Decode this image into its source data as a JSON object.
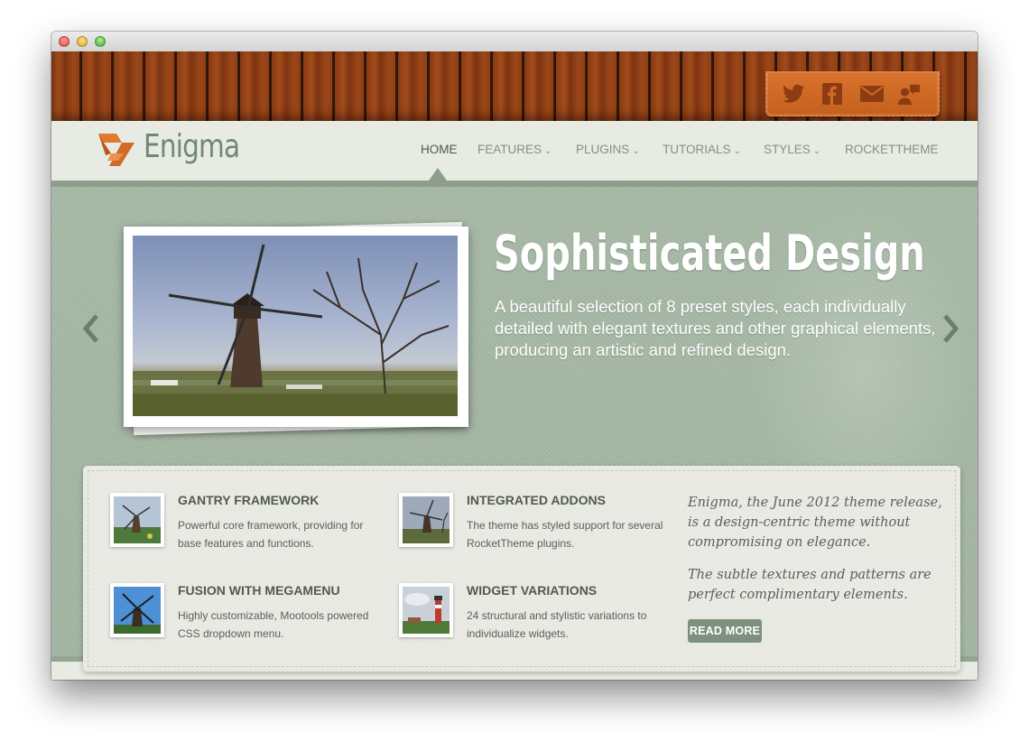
{
  "site": {
    "logo_text": "Enigma",
    "nav": [
      {
        "label": "HOME",
        "dropdown": false,
        "active": true
      },
      {
        "label": "FEATURES",
        "dropdown": true,
        "active": false
      },
      {
        "label": "PLUGINS",
        "dropdown": true,
        "active": false
      },
      {
        "label": "TUTORIALS",
        "dropdown": true,
        "active": false
      },
      {
        "label": "STYLES",
        "dropdown": true,
        "active": false
      },
      {
        "label": "ROCKETTHEME",
        "dropdown": false,
        "active": false
      }
    ],
    "dropdown_glyph": "⌄"
  },
  "social_icons": [
    "twitter-icon",
    "facebook-icon",
    "email-icon",
    "chat-icon"
  ],
  "slide": {
    "title": "Sophisticated Design",
    "text": "A beautiful selection of 8 preset styles, each individually detailed with elegant textures and other graphical elements, producing an artistic and refined design.",
    "image": "windmill-photo"
  },
  "features": [
    {
      "title": "GANTRY FRAMEWORK",
      "text": "Powerful core framework, providing for base features and functions.",
      "image": "windmill-thumb"
    },
    {
      "title": "INTEGRATED ADDONS",
      "text": "The theme has styled support for several RocketTheme plugins.",
      "image": "windmill-thumb"
    },
    {
      "title": "FUSION WITH MEGAMENU",
      "text": "Highly customizable, Mootools powered CSS dropdown menu.",
      "image": "windmill-blue-sky-thumb"
    },
    {
      "title": "WIDGET VARIATIONS",
      "text": "24 structural and stylistic variations to individualize widgets.",
      "image": "lighthouse-thumb"
    }
  ],
  "intro": {
    "paragraph_1": "Enigma, the June 2012 theme release, is a design-centric theme without compromising on elegance.",
    "paragraph_2": "The subtle textures and patterns are perfect complimentary elements.",
    "read_more": "READ MORE"
  },
  "colors": {
    "accent_orange": "#d06a26",
    "sage_green": "#a5b8a4",
    "nav_text": "#7d937e",
    "button": "#7d917e"
  }
}
